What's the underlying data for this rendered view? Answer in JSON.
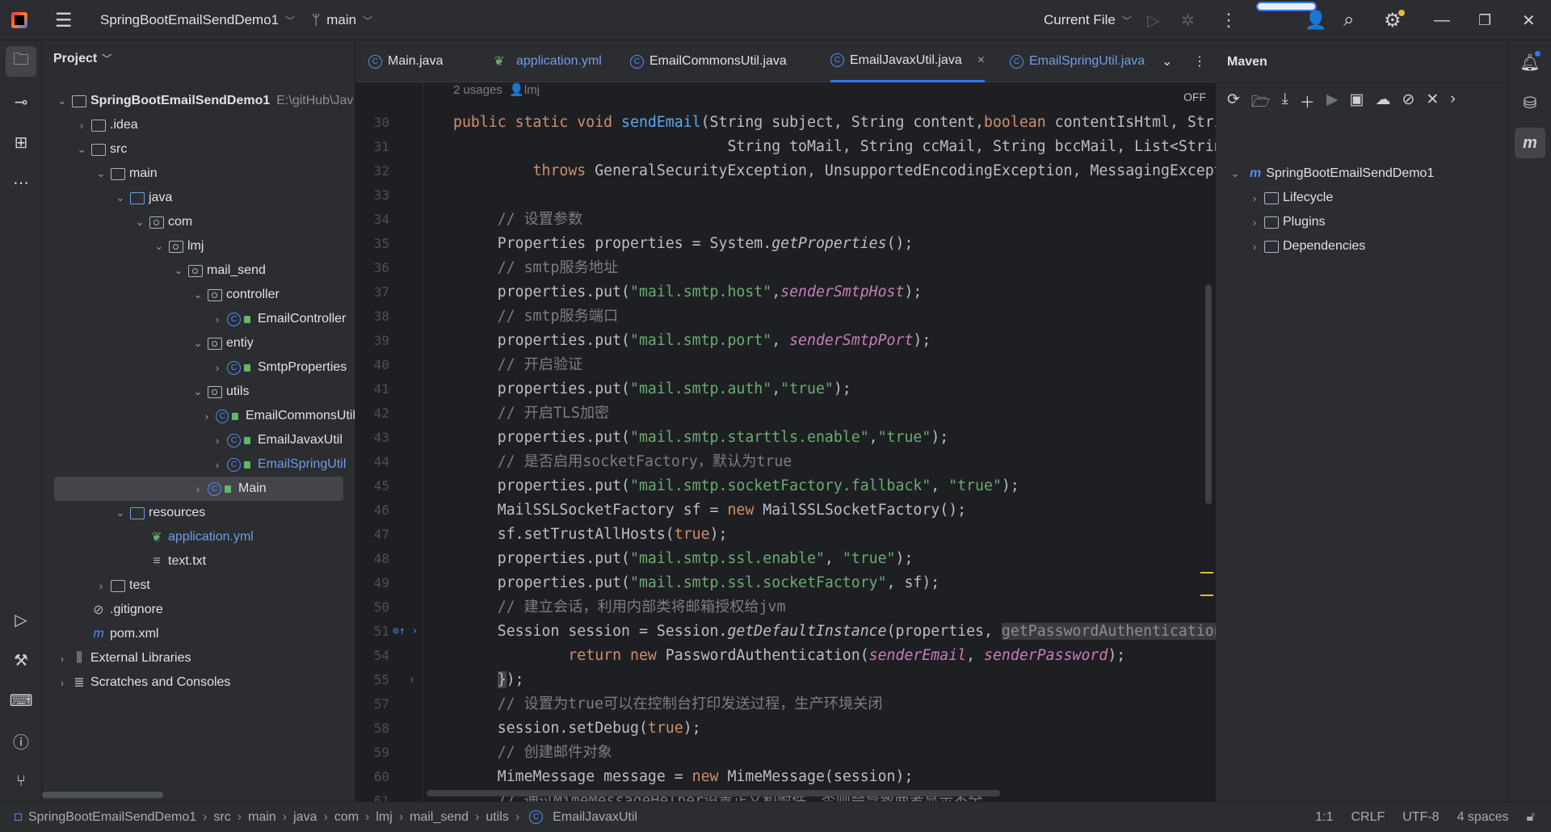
{
  "titlebar": {
    "project": "SpringBootEmailSendDemo1",
    "branch": "main",
    "run_config": "Current File"
  },
  "project": {
    "title": "Project",
    "tree": [
      {
        "level": 0,
        "chev": "open",
        "icon": "module-folder",
        "label": "SpringBootEmailSendDemo1",
        "bold": true,
        "path": "E:\\gitHub\\Jav"
      },
      {
        "level": 1,
        "chev": "closed",
        "icon": "folder",
        "label": ".idea"
      },
      {
        "level": 1,
        "chev": "open",
        "icon": "folder",
        "label": "src"
      },
      {
        "level": 2,
        "chev": "open",
        "icon": "folder",
        "label": "main"
      },
      {
        "level": 3,
        "chev": "open",
        "icon": "source-folder",
        "label": "java"
      },
      {
        "level": 4,
        "chev": "open",
        "icon": "package",
        "label": "com"
      },
      {
        "level": 5,
        "chev": "open",
        "icon": "package",
        "label": "lmj"
      },
      {
        "level": 6,
        "chev": "open",
        "icon": "package",
        "label": "mail_send"
      },
      {
        "level": 7,
        "chev": "open",
        "icon": "package",
        "label": "controller"
      },
      {
        "level": 8,
        "chev": "closed",
        "icon": "class",
        "label": "EmailController"
      },
      {
        "level": 7,
        "chev": "open",
        "icon": "package",
        "label": "entiy"
      },
      {
        "level": 8,
        "chev": "closed",
        "icon": "class",
        "label": "SmtpProperties"
      },
      {
        "level": 7,
        "chev": "open",
        "icon": "package",
        "label": "utils"
      },
      {
        "level": 8,
        "chev": "closed",
        "icon": "class",
        "label": "EmailCommonsUtil"
      },
      {
        "level": 8,
        "chev": "closed",
        "icon": "class",
        "label": "EmailJavaxUtil"
      },
      {
        "level": 8,
        "chev": "closed",
        "icon": "class",
        "label": "EmailSpringUtil",
        "color": "#6e9de8"
      },
      {
        "level": 7,
        "chev": "closed",
        "icon": "main-class",
        "label": "Main",
        "selected": true
      },
      {
        "level": 3,
        "chev": "open",
        "icon": "resources-folder",
        "label": "resources"
      },
      {
        "level": 4,
        "chev": "none",
        "icon": "yaml",
        "label": "application.yml",
        "color": "#6e9de8"
      },
      {
        "level": 4,
        "chev": "none",
        "icon": "text-file",
        "label": "text.txt"
      },
      {
        "level": 2,
        "chev": "closed",
        "icon": "folder",
        "label": "test"
      },
      {
        "level": 1,
        "chev": "none",
        "icon": "gitignore",
        "label": ".gitignore"
      },
      {
        "level": 1,
        "chev": "none",
        "icon": "maven",
        "label": "pom.xml"
      },
      {
        "level": 0,
        "chev": "closed",
        "icon": "library",
        "label": "External Libraries"
      },
      {
        "level": 0,
        "chev": "closed",
        "icon": "scratch",
        "label": "Scratches and Consoles"
      }
    ]
  },
  "tabs": [
    {
      "label": "Main.java",
      "icon": "class"
    },
    {
      "label": "application.yml",
      "icon": "yaml",
      "color": "#6e9de8"
    },
    {
      "label": "EmailCommonsUtil.java",
      "icon": "class"
    },
    {
      "label": "EmailJavaxUtil.java",
      "icon": "class",
      "active": true
    },
    {
      "label": "EmailSpringUtil.java",
      "icon": "class",
      "color": "#6e9de8"
    }
  ],
  "editor": {
    "usages": "2 usages",
    "author": "lmj",
    "reader_mode": "OFF",
    "lines": [
      {
        "n": "30",
        "t": [
          [
            "kw",
            "public static void "
          ],
          [
            "fn",
            "sendEmail"
          ],
          [
            "",
            "(String subject, String content,"
          ],
          [
            "kw",
            "boolean"
          ],
          [
            "",
            " contentIsHtml, String fromName,"
          ]
        ]
      },
      {
        "n": "31",
        "t": [
          [
            "",
            "                               String toMail, String ccMail, String bccMail, List<String> attachments)"
          ]
        ]
      },
      {
        "n": "32",
        "t": [
          [
            "",
            "         "
          ],
          [
            "kw",
            "throws"
          ],
          [
            "",
            " GeneralSecurityException, UnsupportedEncodingException, MessagingException {"
          ]
        ]
      },
      {
        "n": "33",
        "t": []
      },
      {
        "n": "34",
        "t": [
          [
            "cm",
            "     // 设置参数"
          ]
        ]
      },
      {
        "n": "35",
        "t": [
          [
            "",
            "     Properties properties = System."
          ],
          [
            "sit",
            "getProperties"
          ],
          [
            "",
            "();"
          ]
        ]
      },
      {
        "n": "36",
        "t": [
          [
            "cm",
            "     // smtp服务地址"
          ]
        ]
      },
      {
        "n": "37",
        "t": [
          [
            "",
            "     properties.put("
          ],
          [
            "str",
            "\"mail.smtp.host\""
          ],
          [
            "",
            ","
          ],
          [
            "it",
            "senderSmtpHost"
          ],
          [
            "",
            ");"
          ]
        ]
      },
      {
        "n": "38",
        "t": [
          [
            "cm",
            "     // smtp服务端口"
          ]
        ]
      },
      {
        "n": "39",
        "t": [
          [
            "",
            "     properties.put("
          ],
          [
            "str",
            "\"mail.smtp.port\""
          ],
          [
            "",
            ", "
          ],
          [
            "it",
            "senderSmtpPort"
          ],
          [
            "",
            ");"
          ]
        ]
      },
      {
        "n": "40",
        "t": [
          [
            "cm",
            "     // 开启验证"
          ]
        ]
      },
      {
        "n": "41",
        "t": [
          [
            "",
            "     properties.put("
          ],
          [
            "str",
            "\"mail.smtp.auth\""
          ],
          [
            "",
            ","
          ],
          [
            "str",
            "\"true\""
          ],
          [
            "",
            ");"
          ]
        ]
      },
      {
        "n": "42",
        "t": [
          [
            "cm",
            "     // 开启TLS加密"
          ]
        ]
      },
      {
        "n": "43",
        "t": [
          [
            "",
            "     properties.put("
          ],
          [
            "str",
            "\"mail.smtp.starttls.enable\""
          ],
          [
            "",
            ","
          ],
          [
            "str",
            "\"true\""
          ],
          [
            "",
            ");"
          ]
        ]
      },
      {
        "n": "44",
        "t": [
          [
            "cm",
            "     // 是否启用socketFactory，默认为true"
          ]
        ]
      },
      {
        "n": "45",
        "t": [
          [
            "",
            "     properties.put("
          ],
          [
            "str",
            "\"mail.smtp.socketFactory.fallback\""
          ],
          [
            "",
            ", "
          ],
          [
            "str",
            "\"true\""
          ],
          [
            "",
            ");"
          ]
        ]
      },
      {
        "n": "46",
        "t": [
          [
            "",
            "     MailSSLSocketFactory sf = "
          ],
          [
            "kw",
            "new"
          ],
          [
            "",
            " MailSSLSocketFactory();"
          ]
        ]
      },
      {
        "n": "47",
        "t": [
          [
            "",
            "     sf.setTrustAllHosts("
          ],
          [
            "kw",
            "true"
          ],
          [
            "",
            ");"
          ]
        ]
      },
      {
        "n": "48",
        "t": [
          [
            "",
            "     properties.put("
          ],
          [
            "str",
            "\"mail.smtp.ssl.enable\""
          ],
          [
            "",
            ", "
          ],
          [
            "str",
            "\"true\""
          ],
          [
            "",
            ");"
          ]
        ]
      },
      {
        "n": "49",
        "t": [
          [
            "",
            "     properties.put("
          ],
          [
            "str",
            "\"mail.smtp.ssl.socketFactory\""
          ],
          [
            "",
            ", sf);"
          ]
        ]
      },
      {
        "n": "50",
        "t": [
          [
            "cm",
            "     // 建立会话，利用内部类将邮箱授权给jvm"
          ]
        ]
      },
      {
        "n": "51",
        "t": [
          [
            "",
            "     Session session = Session."
          ],
          [
            "sit",
            "getDefaultInstance"
          ],
          [
            "",
            "(properties, "
          ],
          [
            "hint",
            "getPasswordAuthentication() {"
          ]
        ]
      },
      {
        "n": "54",
        "t": [
          [
            "",
            "             "
          ],
          [
            "kw",
            "return new"
          ],
          [
            "",
            " PasswordAuthentication("
          ],
          [
            "it",
            "senderEmail"
          ],
          [
            "",
            ", "
          ],
          [
            "it",
            "senderPassword"
          ],
          [
            "",
            ");"
          ]
        ]
      },
      {
        "n": "55",
        "t": [
          [
            "",
            "     "
          ],
          [
            "brace",
            "}"
          ],
          [
            "",
            ");"
          ]
        ]
      },
      {
        "n": "57",
        "t": [
          [
            "cm",
            "     // 设置为true可以在控制台打印发送过程，生产环境关闭"
          ]
        ]
      },
      {
        "n": "58",
        "t": [
          [
            "",
            "     session.setDebug("
          ],
          [
            "kw",
            "true"
          ],
          [
            "",
            ");"
          ]
        ]
      },
      {
        "n": "59",
        "t": [
          [
            "cm",
            "     // 创建邮件对象"
          ]
        ]
      },
      {
        "n": "60",
        "t": [
          [
            "",
            "     MimeMessage message = "
          ],
          [
            "kw",
            "new"
          ],
          [
            "",
            " MimeMessage(session);"
          ]
        ]
      },
      {
        "n": "61",
        "t": [
          [
            "cm",
            "     // 通过MimeMessageHelper设置正文和附件，否则会导致两者显示不全"
          ]
        ]
      }
    ]
  },
  "maven": {
    "title": "Maven",
    "root": "SpringBootEmailSendDemo1",
    "items": [
      "Lifecycle",
      "Plugins",
      "Dependencies"
    ]
  },
  "status": {
    "breadcrumb": [
      "SpringBootEmailSendDemo1",
      "src",
      "main",
      "java",
      "com",
      "lmj",
      "mail_send",
      "utils",
      "EmailJavaxUtil"
    ],
    "position": "1:1",
    "line_sep": "CRLF",
    "encoding": "UTF-8",
    "indent": "4 spaces"
  },
  "colors": {
    "accent": "#3574f0",
    "keyword": "#cf8e6d",
    "string": "#6aab73",
    "function": "#56a8f5",
    "field": "#c77dbb",
    "comment": "#7a7e85"
  }
}
